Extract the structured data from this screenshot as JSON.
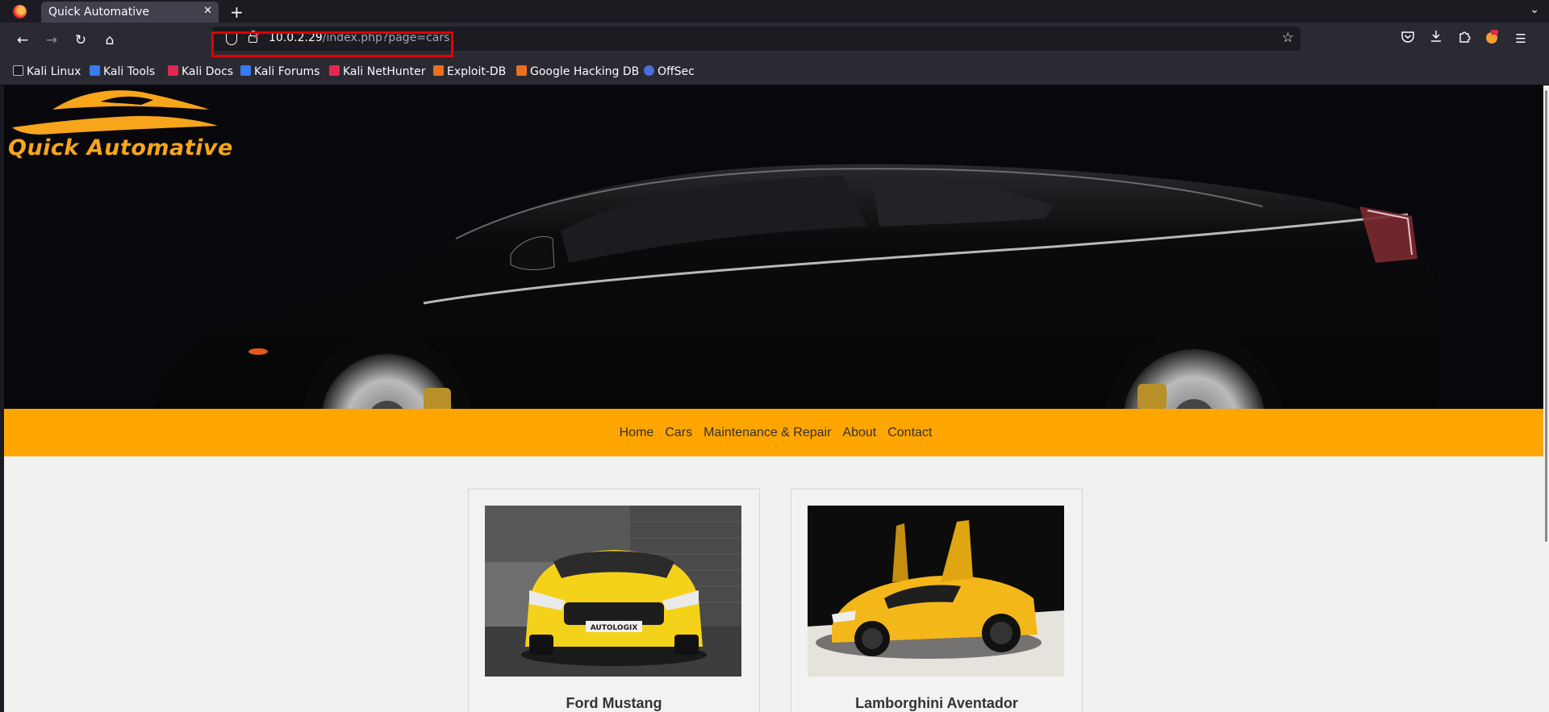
{
  "browser": {
    "tab_title": "Quick Automative",
    "tab_close_glyph": "✕",
    "new_tab_glyph": "+",
    "url_host": "10.0.2.29",
    "url_path": "/index.php?page=cars",
    "bookmarks": [
      {
        "label": "Kali Linux",
        "color": "#1c1b22"
      },
      {
        "label": "Kali Tools",
        "color": "#367bf0"
      },
      {
        "label": "Kali Docs",
        "color": "#e22850"
      },
      {
        "label": "Kali Forums",
        "color": "#367bf0"
      },
      {
        "label": "Kali NetHunter",
        "color": "#e22850"
      },
      {
        "label": "Exploit-DB",
        "color": "#ec6f1f"
      },
      {
        "label": "Google Hacking DB",
        "color": "#ec6f1f"
      },
      {
        "label": "OffSec",
        "color": "#4a6fd8"
      }
    ],
    "highlight_color": "#e10000"
  },
  "site": {
    "logo_text": "Quick Automative",
    "accent_color": "#ffa500",
    "nav": [
      "Home",
      "Cars",
      "Maintenance & Repair",
      "About",
      "Contact"
    ],
    "cars": [
      {
        "name": "Ford Mustang",
        "plate": "AUTOLOGIX",
        "color": "#f5d21a"
      },
      {
        "name": "Lamborghini Aventador",
        "color": "#f4b71a"
      }
    ]
  }
}
